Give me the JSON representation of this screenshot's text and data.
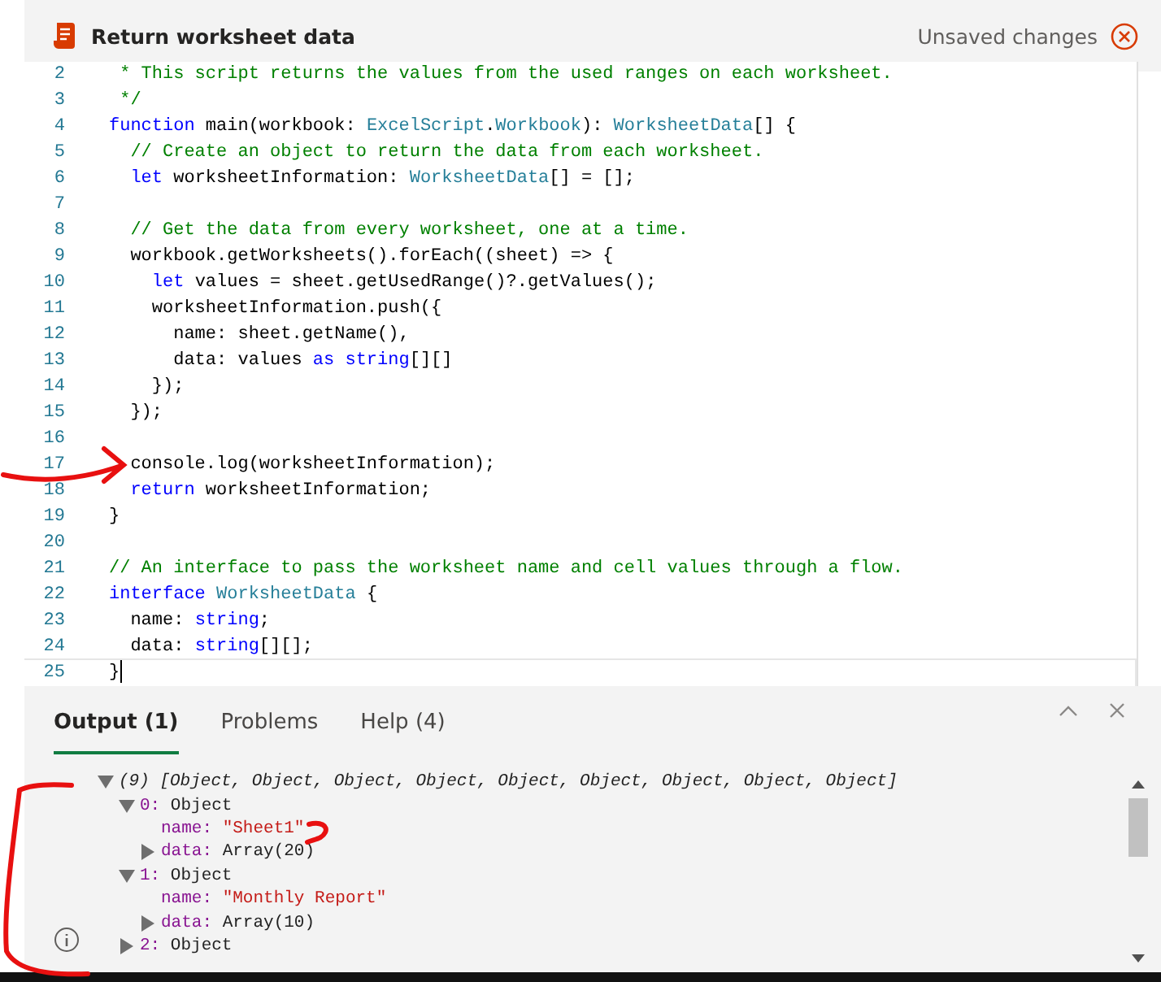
{
  "header": {
    "title": "Return worksheet data",
    "status": "Unsaved changes"
  },
  "editor": {
    "lines": [
      {
        "number": "2",
        "current": false,
        "tokens": [
          {
            "kind": "comment",
            "text": " * This script returns the values from the used ranges on each worksheet."
          }
        ]
      },
      {
        "number": "3",
        "current": false,
        "tokens": [
          {
            "kind": "comment",
            "text": " */"
          }
        ]
      },
      {
        "number": "4",
        "current": false,
        "tokens": [
          {
            "kind": "keyword",
            "text": "function"
          },
          {
            "kind": "plain",
            "text": " main(workbook: "
          },
          {
            "kind": "type",
            "text": "ExcelScript"
          },
          {
            "kind": "plain",
            "text": "."
          },
          {
            "kind": "type",
            "text": "Workbook"
          },
          {
            "kind": "plain",
            "text": "): "
          },
          {
            "kind": "type",
            "text": "WorksheetData"
          },
          {
            "kind": "plain",
            "text": "[] {"
          }
        ]
      },
      {
        "number": "5",
        "current": false,
        "tokens": [
          {
            "kind": "comment",
            "text": "  // Create an object to return the data from each worksheet."
          }
        ]
      },
      {
        "number": "6",
        "current": false,
        "tokens": [
          {
            "kind": "keyword",
            "text": "  let"
          },
          {
            "kind": "plain",
            "text": " worksheetInformation: "
          },
          {
            "kind": "type",
            "text": "WorksheetData"
          },
          {
            "kind": "plain",
            "text": "[] = [];"
          }
        ]
      },
      {
        "number": "7",
        "current": false
      },
      {
        "number": "8",
        "current": false,
        "tokens": [
          {
            "kind": "comment",
            "text": "  // Get the data from every worksheet, one at a time."
          }
        ]
      },
      {
        "number": "9",
        "current": false,
        "tokens": [
          {
            "kind": "plain",
            "text": "  workbook.getWorksheets().forEach((sheet) => {"
          }
        ]
      },
      {
        "number": "10",
        "current": false,
        "tokens": [
          {
            "kind": "keyword",
            "text": "    let"
          },
          {
            "kind": "plain",
            "text": " values = sheet.getUsedRange()?.getValues();"
          }
        ]
      },
      {
        "number": "11",
        "current": false,
        "tokens": [
          {
            "kind": "plain",
            "text": "    worksheetInformation.push({"
          }
        ]
      },
      {
        "number": "12",
        "current": false,
        "tokens": [
          {
            "kind": "plain",
            "text": "      name: sheet.getName(),"
          }
        ]
      },
      {
        "number": "13",
        "current": false,
        "tokens": [
          {
            "kind": "plain",
            "text": "      data: values "
          },
          {
            "kind": "keyword",
            "text": "as string"
          },
          {
            "kind": "plain",
            "text": "[][]"
          }
        ]
      },
      {
        "number": "14",
        "current": false,
        "tokens": [
          {
            "kind": "plain",
            "text": "    });"
          }
        ]
      },
      {
        "number": "15",
        "current": false,
        "tokens": [
          {
            "kind": "plain",
            "text": "  });"
          }
        ]
      },
      {
        "number": "16",
        "current": false
      },
      {
        "number": "17",
        "current": false,
        "tokens": [
          {
            "kind": "plain",
            "text": "  console.log(worksheetInformation);"
          }
        ]
      },
      {
        "number": "18",
        "current": false,
        "tokens": [
          {
            "kind": "keyword",
            "text": "  return"
          },
          {
            "kind": "plain",
            "text": " worksheetInformation;"
          }
        ]
      },
      {
        "number": "19",
        "current": false,
        "tokens": [
          {
            "kind": "plain",
            "text": "}"
          }
        ]
      },
      {
        "number": "20",
        "current": false
      },
      {
        "number": "21",
        "current": false,
        "tokens": [
          {
            "kind": "comment",
            "text": "// An interface to pass the worksheet name and cell values through a flow."
          }
        ]
      },
      {
        "number": "22",
        "current": false,
        "tokens": [
          {
            "kind": "keyword",
            "text": "interface"
          },
          {
            "kind": "type",
            "text": " WorksheetData"
          },
          {
            "kind": "plain",
            "text": " {"
          }
        ]
      },
      {
        "number": "23",
        "current": false,
        "tokens": [
          {
            "kind": "plain",
            "text": "  name: "
          },
          {
            "kind": "keyword",
            "text": "string"
          },
          {
            "kind": "plain",
            "text": ";"
          }
        ]
      },
      {
        "number": "24",
        "current": false,
        "tokens": [
          {
            "kind": "plain",
            "text": "  data: "
          },
          {
            "kind": "keyword",
            "text": "string"
          },
          {
            "kind": "plain",
            "text": "[][];"
          }
        ]
      },
      {
        "number": "25",
        "current": true,
        "tokens": [
          {
            "kind": "plain",
            "text": "}"
          }
        ]
      }
    ]
  },
  "output": {
    "tabs": [
      {
        "label": "Output (1)",
        "selected": true
      },
      {
        "label": "Problems",
        "selected": false
      },
      {
        "label": "Help (4)",
        "selected": false
      }
    ],
    "tree": [
      {
        "kind": "summary",
        "value": "(9) [Object, Object, Object, Object, Object, Object, Object, Object, Object]",
        "expanded": true,
        "children": [
          {
            "kind": "object",
            "key": "0:",
            "value": "Object",
            "expanded": true,
            "children": [
              {
                "kind": "string",
                "key": "name:",
                "value": "\"Sheet1\""
              },
              {
                "kind": "object",
                "key": "data:",
                "value": "Array(20)",
                "expanded": false
              }
            ]
          },
          {
            "kind": "object",
            "key": "1:",
            "value": "Object",
            "expanded": true,
            "children": [
              {
                "kind": "string",
                "key": "name:",
                "value": "\"Monthly Report\""
              },
              {
                "kind": "object",
                "key": "data:",
                "value": "Array(10)",
                "expanded": false
              }
            ]
          },
          {
            "kind": "object",
            "key": "2:",
            "value": "Object",
            "expanded": false
          }
        ]
      }
    ]
  }
}
